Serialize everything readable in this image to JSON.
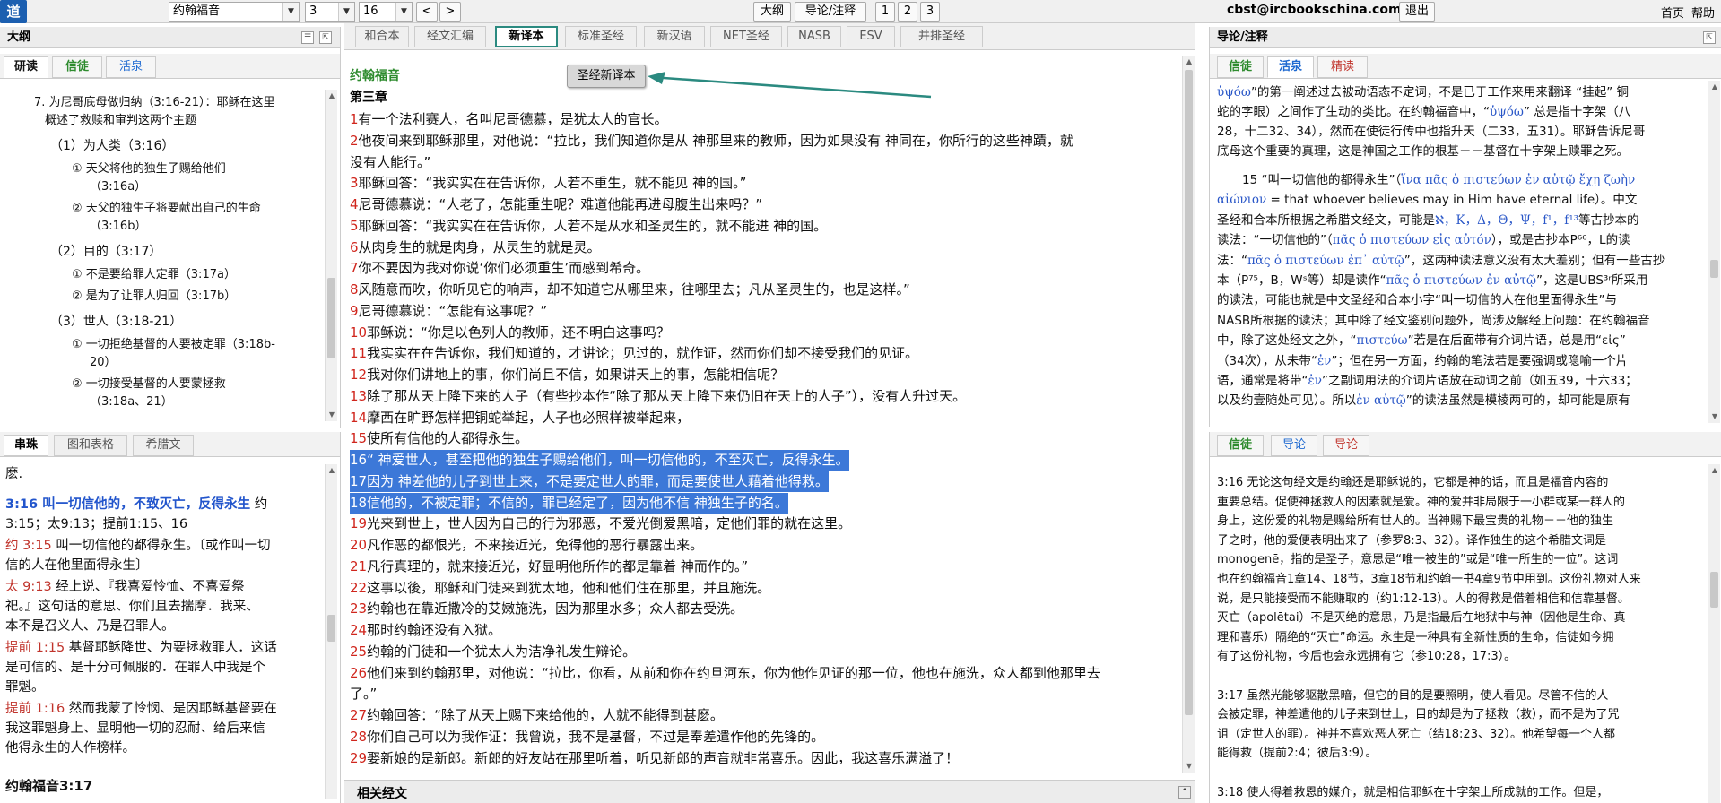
{
  "topbar": {
    "logo": "道",
    "book": "约翰福音",
    "chapter": "3",
    "verse": "16",
    "prev": "<",
    "next": ">",
    "outline_btn": "大纲",
    "notes_btn": "导论/注释",
    "page1": "1",
    "page2": "2",
    "page3": "3",
    "email": "cbst@ircbookschina.com",
    "logout": "退出",
    "home": "首页",
    "help": "帮助"
  },
  "outline": {
    "title": "大纲",
    "tabs": [
      "研读",
      "信徒",
      "活泉"
    ],
    "lines": [
      "7.  为尼哥底母做归纳（3:16-21）：耶稣在这里",
      "概述了救赎和审判这两个主题",
      "（1）为人类（3:16）",
      "① 天父将他的独生子赐给他们",
      "（3:16a）",
      "② 天父的独生子将要献出自己的生命",
      "（3:16b）",
      "（2）目的（3:17）",
      "① 不是要给罪人定罪（3:17a）",
      "② 是为了让罪人归回（3:17b）",
      "（3）世人（3:18-21）",
      "① 一切拒绝基督的人要被定罪（3:18b-",
      "20）",
      "② 一切接受基督的人要蒙拯救",
      "（3:18a、21）"
    ]
  },
  "crossref": {
    "tabs": [
      "串珠",
      "图和表格",
      "希腊文"
    ],
    "line0": "麽.",
    "ref1_head": "3:16 叫一切信他的，不致灭亡，反得永生",
    "ref1_tail": " 约",
    "ref1_line2": "3:15；太9:13；提前1:15、16",
    "ref2_ref": "约 3:15",
    "ref2_text": " 叫一切信他的都得永生。〔或作叫一切",
    "ref2_line2": "信的人在他里面得永生〕",
    "ref3_ref": "太 9:13",
    "ref3_text": " 经上说、『我喜爱怜恤、不喜爱祭",
    "ref3_line2": "祀。』这句话的意思、你们且去揣摩．我来、",
    "ref3_line3": "本不是召义人、乃是召罪人。",
    "ref4_ref": "提前 1:15",
    "ref4_text": " 基督耶稣降世、为要拯救罪人．这话",
    "ref4_line2": "是可信的、是十分可佩服的．在罪人中我是个",
    "ref4_line3": "罪魁。",
    "ref5_ref": "提前 1:16",
    "ref5_text": " 然而我蒙了怜悯、是因耶稣基督要在",
    "ref5_line2": "我这罪魁身上、显明他一切的忍耐、给后来信",
    "ref5_line3": "他得永生的人作榜样。",
    "next_head": "约翰福音3:17"
  },
  "versions": {
    "tabs": [
      "和合本",
      "经文汇编",
      "新译本",
      "标准圣经",
      "新汉语",
      "NET圣经",
      "NASB",
      "ESV",
      "并排圣经"
    ],
    "active_index": 2,
    "tooltip": "圣经新译本"
  },
  "bible": {
    "book": "约翰福音",
    "chapter": "第三章",
    "verses": [
      {
        "n": "1",
        "t": "有一个法利赛人，名叫尼哥德慕，是犹太人的官长。"
      },
      {
        "n": "2",
        "t": "他夜间来到耶稣那里，对他说：“拉比，我们知道你是从  神那里来的教师，因为如果没有  神同在，你所行的这些神蹟，就"
      },
      {
        "n": "",
        "t": "没有人能行。”"
      },
      {
        "n": "3",
        "t": "耶稣回答：“我实实在在告诉你，人若不重生，就不能见  神的国。”"
      },
      {
        "n": "4",
        "t": "尼哥德慕说：“人老了，怎能重生呢？难道他能再进母腹生出来吗？”"
      },
      {
        "n": "5",
        "t": "耶稣回答：“我实实在在告诉你，人若不是从水和圣灵生的，就不能进  神的国。"
      },
      {
        "n": "6",
        "t": "从肉身生的就是肉身，从灵生的就是灵。"
      },
      {
        "n": "7",
        "t": "你不要因为我对你说‘你们必须重生’而感到希奇。"
      },
      {
        "n": "8",
        "t": "风随意而吹，你听见它的响声，却不知道它从哪里来，往哪里去；凡从圣灵生的，也是这样。”"
      },
      {
        "n": "9",
        "t": "尼哥德慕说：“怎能有这事呢？”"
      },
      {
        "n": "10",
        "t": "耶稣说：“你是以色列人的教师，还不明白这事吗？"
      },
      {
        "n": "11",
        "t": "我实实在在告诉你，我们知道的，才讲论；见过的，就作证，然而你们却不接受我们的见证。"
      },
      {
        "n": "12",
        "t": "我对你们讲地上的事，你们尚且不信，如果讲天上的事，怎能相信呢？"
      },
      {
        "n": "13",
        "t": "除了那从天上降下来的人子（有些抄本作“除了那从天上降下来仍旧在天上的人子”），没有人升过天。"
      },
      {
        "n": "14",
        "t": "摩西在旷野怎样把铜蛇举起，人子也必照样被举起来，"
      },
      {
        "n": "15",
        "t": "使所有信他的人都得永生。"
      },
      {
        "n": "16",
        "t": "“  神爱世人，甚至把他的独生子赐给他们，叫一切信他的，不至灭亡，反得永生。"
      },
      {
        "n": "17",
        "t": "因为  神差他的儿子到世上来，不是要定世人的罪，而是要使世人藉着他得救。"
      },
      {
        "n": "18",
        "t": "信他的，不被定罪；不信的，罪已经定了，因为他不信  神独生子的名。"
      },
      {
        "n": "19",
        "t": "光来到世上，世人因为自己的行为邪恶，不爱光倒爱黑暗，定他们罪的就在这里。"
      },
      {
        "n": "20",
        "t": "凡作恶的都恨光，不来接近光，免得他的恶行暴露出来。"
      },
      {
        "n": "21",
        "t": "凡行真理的，就来接近光，好显明他所作的都是靠着  神而作的。”"
      },
      {
        "n": "22",
        "t": "这事以後，耶稣和门徒来到犹太地，他和他们住在那里，并且施洗。"
      },
      {
        "n": "23",
        "t": "约翰也在靠近撒冷的艾嫩施洗，因为那里水多；众人都去受洗。"
      },
      {
        "n": "24",
        "t": "那时约翰还没有入狱。"
      },
      {
        "n": "25",
        "t": "约翰的门徒和一个犹太人为洁净礼发生辩论。"
      },
      {
        "n": "26",
        "t": "他们来到约翰那里，对他说：“拉比，你看，从前和你在约旦河东，你为他作见证的那一位，他也在施洗，众人都到他那里去"
      },
      {
        "n": "",
        "t": "了。”"
      },
      {
        "n": "27",
        "t": "约翰回答：“除了从天上赐下来给他的，人就不能得到甚麽。"
      },
      {
        "n": "28",
        "t": "你们自己可以为我作证：我曾说，我不是基督，不过是奉差遣作他的先锋的。"
      },
      {
        "n": "29",
        "t": "娶新娘的是新郎。新郎的好友站在那里听着，听见新郎的声音就非常喜乐。因此，我这喜乐满溢了！"
      }
    ],
    "related_title": "相关经文"
  },
  "notes": {
    "title": "导论/注释",
    "top_tabs": [
      "信徒",
      "活泉",
      "精读"
    ],
    "top_lines": [
      {
        "pre": "",
        "greek": "ὑψόω",
        "post": "”的第一阐述过去被动语态不定词，不是已于工作来用来翻译 “挂起” 铜"
      },
      {
        "pre": "蛇的字眼）之间作了生动的类比。在约翰福音中，“",
        "greek": "ὑψόω",
        "post": "” 总是指十字架（八"
      },
      {
        "pre": "28，十二32、34），然而在使徒行传中也指升天（二33，五31）。耶稣告诉尼哥",
        "greek": "",
        "post": ""
      },
      {
        "pre": "底母这个重要的真理，这是神国之工作的根基－－基督在十字架上赎罪之死。",
        "greek": "",
        "post": ""
      }
    ],
    "top_para2": [
      {
        "pre": "15 “叫一切信他的都得永生”（",
        "greek": "ἵνα πᾶς ὁ πιστεύων ἐν αὐτῷ ἔχῃ ζωὴν",
        "post": ""
      },
      {
        "pre": "",
        "greek": "αἰώνιον",
        "post": " = that whoever believes may in Him have eternal life）。中文"
      },
      {
        "pre": "圣经和合本所根据之希腊文经文，可能是",
        "greek": "ℵ，K，Δ，Θ，Ψ，f¹，f¹³",
        "post": "等古抄本的"
      },
      {
        "pre": "读法：“一切信他的”（",
        "greek": "πᾶς ὁ πιστεύων εἰς αὐτόν",
        "post": "），或是古抄本P⁶⁶，L的读"
      },
      {
        "pre": "法：“",
        "greek": "πᾶς ὁ πιστεύων ἐπ᾽ αὐτῷ",
        "post": "”，这两种读法意义没有太大差别；但有一些古抄"
      },
      {
        "pre": "本（P⁷⁵，B，Wˢ等）却是读作“",
        "greek": "πᾶς ὁ πιστεύων ἐν αὐτῷ",
        "post": "”，这是UBS³ʳ所采用"
      },
      {
        "pre": "的读法，可能也就是中文圣经和合本小字“叫一切信的人在他里面得永生”与",
        "greek": "",
        "post": ""
      },
      {
        "pre": "NASB所根据的读法；其中除了经文鉴别问题外，尚涉及解经上问题：在约翰福音",
        "greek": "",
        "post": ""
      },
      {
        "pre": "中，除了这处经文之外，“",
        "greek": "πιστεύω",
        "post": "”若是在后面带有介词片语，总是用“εἰς”"
      },
      {
        "pre": "（34次），从未带“",
        "greek": "ἐν",
        "post": "”；但在另一方面，约翰的笔法若是要强调或隐喻一个片"
      },
      {
        "pre": "语，通常是将带“",
        "greek": "ἐν",
        "post": "”之副词用法的介词片语放在动词之前（如五39，十六33；"
      },
      {
        "pre": "以及约壹随处可见）。所以",
        "greek": "ἐν αὐτῷ",
        "post": "”的读法虽然是模棱两可的，却可能是原有"
      }
    ],
    "bottom_tabs": [
      "信徒",
      "导论",
      "导论"
    ],
    "bottom_lines": [
      "    3:16 无论这句经文是约翰还是耶稣说的，它都是神的话，而且是福音内容的",
      "重要总结。促使神拯救人的因素就是爱。神的爱并非局限于一小群或某一群人的",
      "身上，这份爱的礼物是赐给所有世人的。当神赐下最宝贵的礼物－－他的独生",
      "子之时，他的爱便表明出来了（参罗8:3、32）。译作独生的这个希腊文词是",
      "monogenē，指的是圣子，意思是“唯一被生的”或是“唯一所生的一位”。这词",
      "也在约翰福音1章14、18节，3章18节和约翰一书4章9节中用到。这份礼物对人来",
      "说，是只能接受而不能赚取的（约1:12-13）。人的得救是借着相信和信靠基督。",
      "灭亡（apolētai）不是灭绝的意思，乃是指最后在地狱中与神（因他是生命、真",
      "理和喜乐）隔绝的“灭亡”命运。永生是一种具有全新性质的生命，信徒如今拥",
      "有了这份礼物，今后也会永远拥有它（参10:28，17:3）。",
      "",
      "    3:17 虽然光能够驱散黑暗，但它的目的是要照明，使人看见。尽管不信的人",
      "会被定罪，神差遣他的儿子来到世上，目的却是为了拯救（救），而不是为了咒",
      "诅（定世人的罪）。神并不喜欢恶人死亡（结18:23、32）。他希望每一个人都",
      "能得救（提前2:4；彼后3:9）。",
      "",
      "    3:18 使人得着救恩的媒介，就是相信耶稣在十字架上所成就的工作。但是，",
      "人若拒绝“道”（Logos）的光照，就落在黑暗中（1:5，8:12），并且他们已经"
    ]
  },
  "colors": {
    "accent_teal": "#2b8a80",
    "verse_number_red": "#d0261d",
    "highlight_blue": "#3c78d8",
    "tab_green": "#2e8b2e",
    "tab_blue": "#1f6ad1",
    "tab_red": "#c0332b",
    "logo_blue": "#1c5fb0"
  }
}
